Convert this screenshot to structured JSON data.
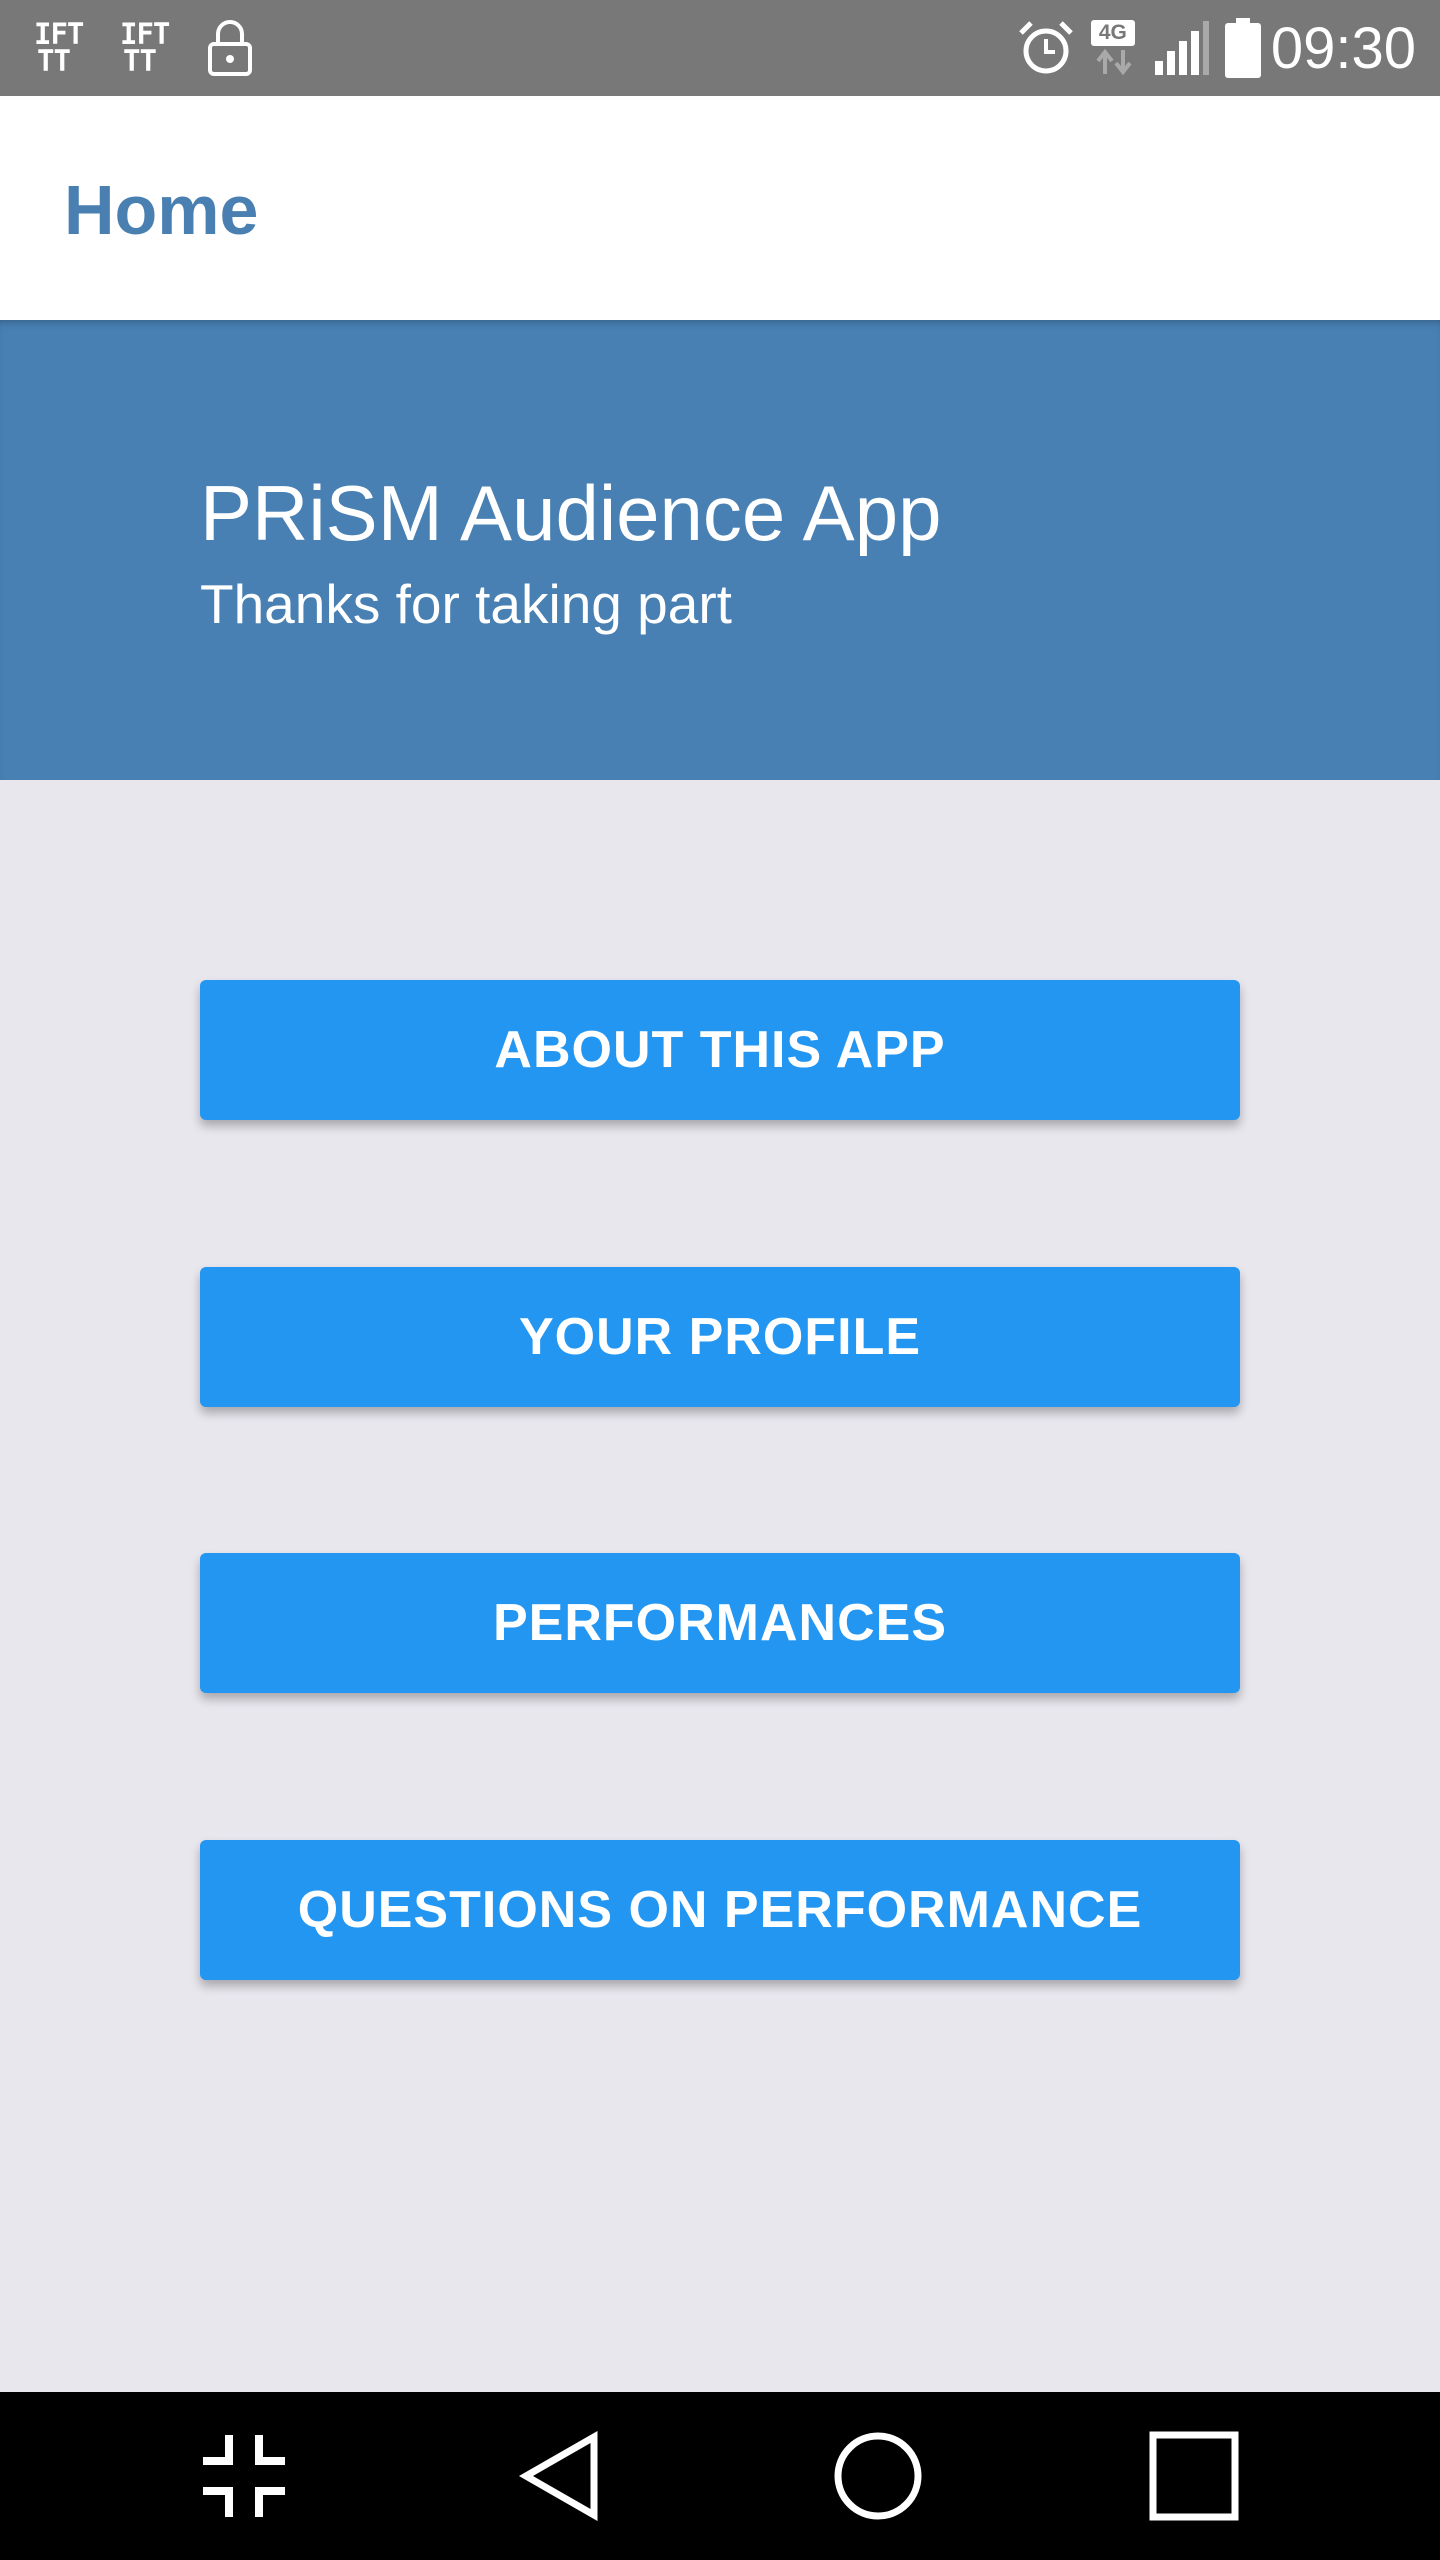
{
  "status_bar": {
    "notif_icons": [
      "ifttt-icon",
      "ifttt-icon",
      "lock-icon"
    ],
    "ifttt_text_top": "IFT",
    "ifttt_text_bottom": "TT",
    "alarm_icon": "alarm-clock-icon",
    "network_type": "4G",
    "signal_icon": "signal-bars-icon",
    "battery_icon": "battery-icon",
    "time": "09:30"
  },
  "app_bar": {
    "title": "Home"
  },
  "hero": {
    "title": "PRiSM Audience App",
    "subtitle": "Thanks for taking part"
  },
  "menu": {
    "buttons": [
      {
        "label": "ABOUT THIS APP"
      },
      {
        "label": "YOUR PROFILE"
      },
      {
        "label": "PERFORMANCES"
      },
      {
        "label": "QUESTIONS ON PERFORMANCE"
      }
    ]
  },
  "nav_bar": {
    "icons": [
      "collapse-icon",
      "back-icon",
      "home-icon",
      "recents-icon"
    ]
  },
  "colors": {
    "status_bar": "#787878",
    "app_title": "#4a7fb1",
    "hero_bg": "#4880b3",
    "page_bg": "#e8e7ee",
    "button_bg": "#2396f2",
    "nav_bar": "#000000"
  }
}
